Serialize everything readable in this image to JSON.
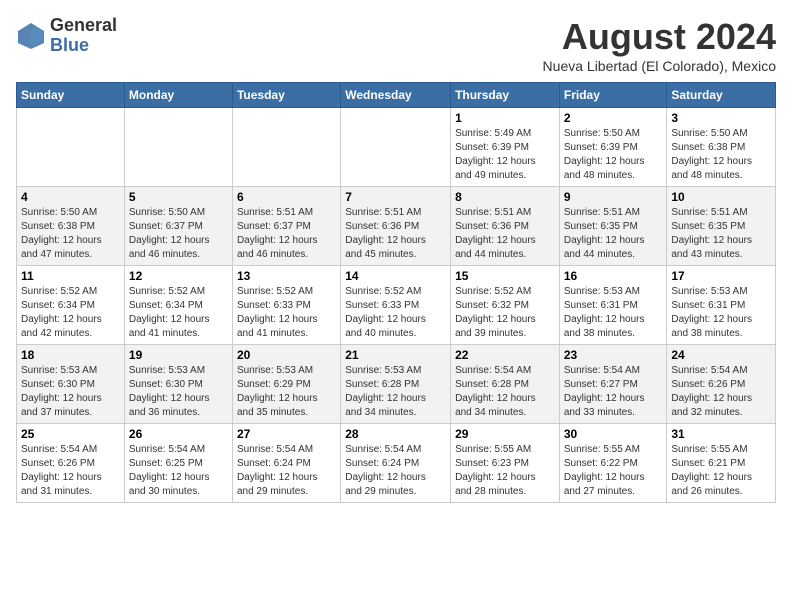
{
  "logo": {
    "general": "General",
    "blue": "Blue"
  },
  "header": {
    "title": "August 2024",
    "subtitle": "Nueva Libertad (El Colorado), Mexico"
  },
  "columns": [
    "Sunday",
    "Monday",
    "Tuesday",
    "Wednesday",
    "Thursday",
    "Friday",
    "Saturday"
  ],
  "weeks": [
    [
      {
        "day": "",
        "info": ""
      },
      {
        "day": "",
        "info": ""
      },
      {
        "day": "",
        "info": ""
      },
      {
        "day": "",
        "info": ""
      },
      {
        "day": "1",
        "info": "Sunrise: 5:49 AM\nSunset: 6:39 PM\nDaylight: 12 hours\nand 49 minutes."
      },
      {
        "day": "2",
        "info": "Sunrise: 5:50 AM\nSunset: 6:39 PM\nDaylight: 12 hours\nand 48 minutes."
      },
      {
        "day": "3",
        "info": "Sunrise: 5:50 AM\nSunset: 6:38 PM\nDaylight: 12 hours\nand 48 minutes."
      }
    ],
    [
      {
        "day": "4",
        "info": "Sunrise: 5:50 AM\nSunset: 6:38 PM\nDaylight: 12 hours\nand 47 minutes."
      },
      {
        "day": "5",
        "info": "Sunrise: 5:50 AM\nSunset: 6:37 PM\nDaylight: 12 hours\nand 46 minutes."
      },
      {
        "day": "6",
        "info": "Sunrise: 5:51 AM\nSunset: 6:37 PM\nDaylight: 12 hours\nand 46 minutes."
      },
      {
        "day": "7",
        "info": "Sunrise: 5:51 AM\nSunset: 6:36 PM\nDaylight: 12 hours\nand 45 minutes."
      },
      {
        "day": "8",
        "info": "Sunrise: 5:51 AM\nSunset: 6:36 PM\nDaylight: 12 hours\nand 44 minutes."
      },
      {
        "day": "9",
        "info": "Sunrise: 5:51 AM\nSunset: 6:35 PM\nDaylight: 12 hours\nand 44 minutes."
      },
      {
        "day": "10",
        "info": "Sunrise: 5:51 AM\nSunset: 6:35 PM\nDaylight: 12 hours\nand 43 minutes."
      }
    ],
    [
      {
        "day": "11",
        "info": "Sunrise: 5:52 AM\nSunset: 6:34 PM\nDaylight: 12 hours\nand 42 minutes."
      },
      {
        "day": "12",
        "info": "Sunrise: 5:52 AM\nSunset: 6:34 PM\nDaylight: 12 hours\nand 41 minutes."
      },
      {
        "day": "13",
        "info": "Sunrise: 5:52 AM\nSunset: 6:33 PM\nDaylight: 12 hours\nand 41 minutes."
      },
      {
        "day": "14",
        "info": "Sunrise: 5:52 AM\nSunset: 6:33 PM\nDaylight: 12 hours\nand 40 minutes."
      },
      {
        "day": "15",
        "info": "Sunrise: 5:52 AM\nSunset: 6:32 PM\nDaylight: 12 hours\nand 39 minutes."
      },
      {
        "day": "16",
        "info": "Sunrise: 5:53 AM\nSunset: 6:31 PM\nDaylight: 12 hours\nand 38 minutes."
      },
      {
        "day": "17",
        "info": "Sunrise: 5:53 AM\nSunset: 6:31 PM\nDaylight: 12 hours\nand 38 minutes."
      }
    ],
    [
      {
        "day": "18",
        "info": "Sunrise: 5:53 AM\nSunset: 6:30 PM\nDaylight: 12 hours\nand 37 minutes."
      },
      {
        "day": "19",
        "info": "Sunrise: 5:53 AM\nSunset: 6:30 PM\nDaylight: 12 hours\nand 36 minutes."
      },
      {
        "day": "20",
        "info": "Sunrise: 5:53 AM\nSunset: 6:29 PM\nDaylight: 12 hours\nand 35 minutes."
      },
      {
        "day": "21",
        "info": "Sunrise: 5:53 AM\nSunset: 6:28 PM\nDaylight: 12 hours\nand 34 minutes."
      },
      {
        "day": "22",
        "info": "Sunrise: 5:54 AM\nSunset: 6:28 PM\nDaylight: 12 hours\nand 34 minutes."
      },
      {
        "day": "23",
        "info": "Sunrise: 5:54 AM\nSunset: 6:27 PM\nDaylight: 12 hours\nand 33 minutes."
      },
      {
        "day": "24",
        "info": "Sunrise: 5:54 AM\nSunset: 6:26 PM\nDaylight: 12 hours\nand 32 minutes."
      }
    ],
    [
      {
        "day": "25",
        "info": "Sunrise: 5:54 AM\nSunset: 6:26 PM\nDaylight: 12 hours\nand 31 minutes."
      },
      {
        "day": "26",
        "info": "Sunrise: 5:54 AM\nSunset: 6:25 PM\nDaylight: 12 hours\nand 30 minutes."
      },
      {
        "day": "27",
        "info": "Sunrise: 5:54 AM\nSunset: 6:24 PM\nDaylight: 12 hours\nand 29 minutes."
      },
      {
        "day": "28",
        "info": "Sunrise: 5:54 AM\nSunset: 6:24 PM\nDaylight: 12 hours\nand 29 minutes."
      },
      {
        "day": "29",
        "info": "Sunrise: 5:55 AM\nSunset: 6:23 PM\nDaylight: 12 hours\nand 28 minutes."
      },
      {
        "day": "30",
        "info": "Sunrise: 5:55 AM\nSunset: 6:22 PM\nDaylight: 12 hours\nand 27 minutes."
      },
      {
        "day": "31",
        "info": "Sunrise: 5:55 AM\nSunset: 6:21 PM\nDaylight: 12 hours\nand 26 minutes."
      }
    ]
  ]
}
